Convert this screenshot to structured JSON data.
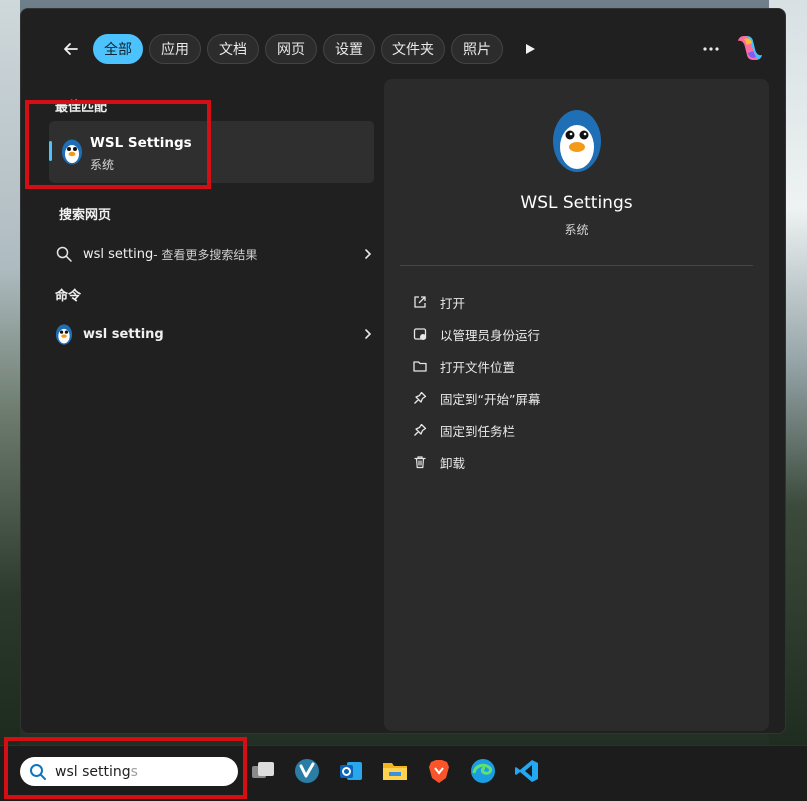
{
  "filters": {
    "active": "全部",
    "chips": [
      "全部",
      "应用",
      "文档",
      "网页",
      "设置",
      "文件夹",
      "照片"
    ]
  },
  "left": {
    "best_match_title": "最佳匹配",
    "best_match": {
      "name": "WSL Settings",
      "subtitle": "系统",
      "icon": "penguin-icon"
    },
    "search_web_title": "搜索网页",
    "web_result": {
      "query": "wsl setting",
      "suffix": " - 查看更多搜索结果"
    },
    "commands_title": "命令",
    "command": {
      "name": "wsl setting",
      "icon": "penguin-icon"
    }
  },
  "detail": {
    "name": "WSL Settings",
    "subtitle": "系统",
    "actions": [
      {
        "label": "打开",
        "icon": "open-external-icon"
      },
      {
        "label": "以管理员身份运行",
        "icon": "run-as-admin-icon"
      },
      {
        "label": "打开文件位置",
        "icon": "folder-icon"
      },
      {
        "label": "固定到“开始”屏幕",
        "icon": "pin-icon"
      },
      {
        "label": "固定到任务栏",
        "icon": "pin-icon"
      },
      {
        "label": "卸载",
        "icon": "trash-icon"
      }
    ]
  },
  "taskbar": {
    "search_value": "wsl setting",
    "search_ghost": "s",
    "apps": [
      "task-view-icon",
      "vivaldi-icon",
      "outlook-icon",
      "file-explorer-icon",
      "brave-icon",
      "edge-icon",
      "vscode-icon"
    ]
  },
  "colors": {
    "accent": "#4cc2ff",
    "highlight": "#d40f14"
  }
}
